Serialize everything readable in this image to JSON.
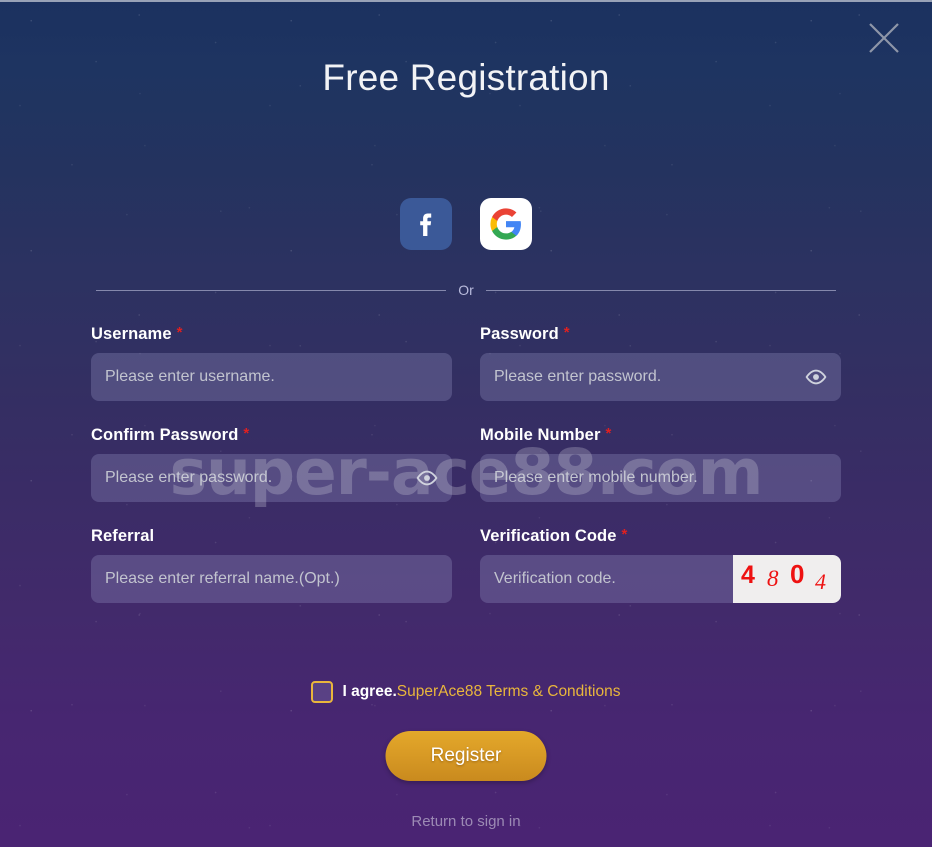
{
  "window": {
    "close_icon": "close-x-icon"
  },
  "header": {
    "title": "Free Registration"
  },
  "social": {
    "facebook_label": "f",
    "facebook_icon": "facebook-icon",
    "google_icon": "google-icon",
    "facebook_color": "#3b5998",
    "google_bg": "#ffffff"
  },
  "divider": {
    "text": "Or"
  },
  "form": {
    "required_mark": "*",
    "fields": [
      {
        "name": "username",
        "label": "Username",
        "required": true,
        "value": "",
        "placeholder": "Please enter username.",
        "type": "text"
      },
      {
        "name": "password",
        "label": "Password",
        "required": true,
        "value": "",
        "placeholder": "Please enter password.",
        "type": "password",
        "toggle_icon": "eye-icon"
      },
      {
        "name": "confirm_password",
        "label": "Confirm Password",
        "required": true,
        "value": "",
        "placeholder": "Please enter password.",
        "type": "password",
        "toggle_icon": "eye-icon"
      },
      {
        "name": "mobile_number",
        "label": "Mobile Number",
        "required": true,
        "value": "",
        "placeholder": "Please enter mobile number.",
        "type": "tel"
      },
      {
        "name": "referral",
        "label": "Referral",
        "required": false,
        "value": "",
        "placeholder": "Please enter referral name.(Opt.)",
        "type": "text"
      },
      {
        "name": "verification_code",
        "label": "Verification Code",
        "required": true,
        "value": "",
        "placeholder": "Verification code.",
        "type": "text"
      }
    ]
  },
  "captcha": {
    "code": "4804",
    "digits": [
      "4",
      "8",
      "0",
      "4"
    ],
    "text_color": "#ee1111",
    "background": "#f0eeee"
  },
  "agreement": {
    "checked": false,
    "prefix": "I agree.",
    "link_text": "SuperAce88 Terms & Conditions",
    "link_color": "#e9b63c"
  },
  "actions": {
    "register_label": "Register",
    "register_color": "#d89a25",
    "return_label": "Return to sign in"
  },
  "watermark": {
    "text": "super-ace88.com"
  }
}
